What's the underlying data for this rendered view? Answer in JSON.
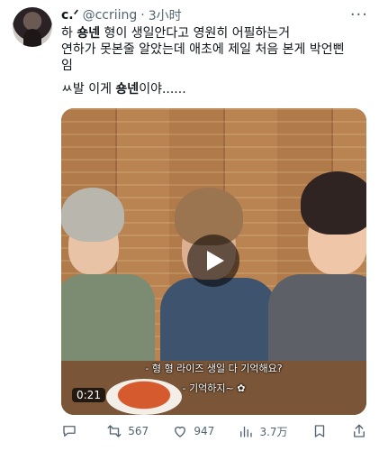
{
  "tweet": {
    "name": "c.ᐟ",
    "handle": "@ccriing",
    "sep": "·",
    "time": "3小时",
    "more": "···",
    "lines": [
      {
        "pre": "하 ",
        "bold": "숑넨",
        "post": " 형이 생일안다고 영원히 어필하는거"
      },
      {
        "text": "연하가 못본줄 알았는데 애초에 제일 처음 본게 박언삔"
      },
      {
        "text": "임"
      },
      {
        "pre": "ㅆ발 이게 ",
        "bold": "숑넨",
        "post": "이야......"
      }
    ]
  },
  "media": {
    "subtitle_line1": "- 형 형 라이즈 생일 다 기억해요?",
    "subtitle_line2": "- 기억하지~ ✿",
    "duration": "0:21"
  },
  "actions": {
    "reply_count": "",
    "retweet_count": "567",
    "like_count": "947",
    "views_count": "3.7万"
  },
  "icons": {
    "reply": "reply-icon",
    "retweet": "retweet-icon",
    "like": "heart-icon",
    "views": "views-icon",
    "bookmark": "bookmark-icon",
    "share": "share-icon",
    "play": "play-icon"
  },
  "colors": {
    "text": "#0f1419",
    "muted": "#536471"
  }
}
